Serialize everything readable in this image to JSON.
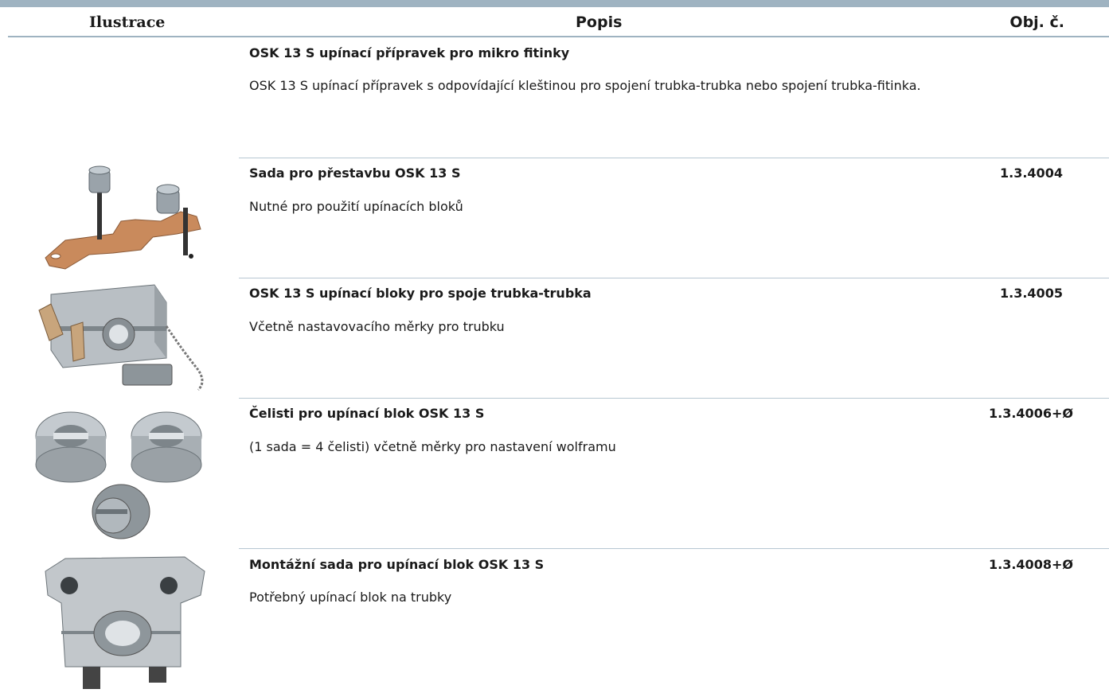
{
  "header": {
    "col_illustration": "Ilustrace",
    "col_description": "Popis",
    "col_order_no": "Obj. č."
  },
  "section": {
    "title": "OSK 13 S upínací přípravek pro mikro fitinky",
    "description": "OSK 13 S upínací přípravek s odpovídající kleštinou pro spojení trubka-trubka nebo spojení trubka-fitinka."
  },
  "rows": [
    {
      "title": "Sada pro přestavbu OSK 13 S",
      "description": "Nutné pro použití upínacích bloků",
      "order_no": "1.3.4004",
      "image": "conversion-kit-illustration"
    },
    {
      "title": "OSK 13 S upínací bloky pro spoje trubka-trubka",
      "description": "Včetně nastavovacího měrky pro trubku",
      "order_no": "1.3.4005",
      "image": "clamping-block-illustration"
    },
    {
      "title": "Čelisti pro upínací blok OSK 13 S",
      "description": "(1 sada = 4 čelisti) včetně měrky pro nastavení wolframu",
      "order_no": "1.3.4006+Ø",
      "image": "jaws-illustration"
    },
    {
      "title": "Montážní sada pro upínací blok OSK 13 S",
      "description": "Potřebný upínací blok na trubky",
      "order_no": "1.3.4008+Ø",
      "image": "mounting-kit-illustration"
    }
  ]
}
